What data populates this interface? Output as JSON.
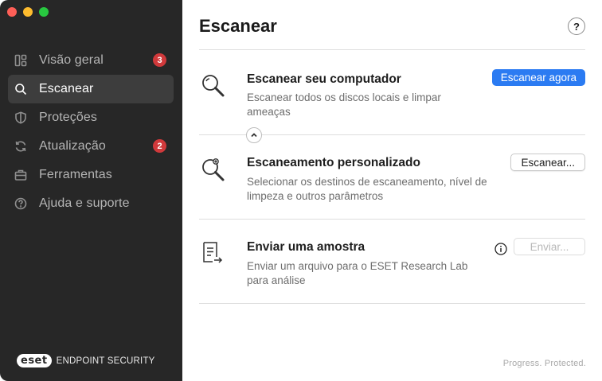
{
  "window": {
    "traffic_lights": [
      "close",
      "minimize",
      "zoom"
    ]
  },
  "sidebar": {
    "items": [
      {
        "label": "Visão geral",
        "icon": "dashboard-icon",
        "badge": "3",
        "active": false
      },
      {
        "label": "Escanear",
        "icon": "search-icon",
        "badge": null,
        "active": true
      },
      {
        "label": "Proteções",
        "icon": "shield-icon",
        "badge": null,
        "active": false
      },
      {
        "label": "Atualização",
        "icon": "refresh-icon",
        "badge": "2",
        "active": false
      },
      {
        "label": "Ferramentas",
        "icon": "briefcase-icon",
        "badge": null,
        "active": false
      },
      {
        "label": "Ajuda e suporte",
        "icon": "help-circle-icon",
        "badge": null,
        "active": false
      }
    ],
    "brand": {
      "logo": "eset",
      "name": "ENDPOINT SECURITY"
    }
  },
  "main": {
    "title": "Escanear",
    "help_label": "?",
    "cards": [
      {
        "title": "Escanear seu computador",
        "description": "Escanear todos os discos locais e limpar ameaças",
        "button": "Escanear agora",
        "icon": "magnifier-icon"
      },
      {
        "title": "Escaneamento personalizado",
        "description": "Selecionar os destinos de escaneamento, nível de limpeza e outros parâmetros",
        "button": "Escanear...",
        "icon": "magnifier-gear-icon"
      },
      {
        "title": "Enviar uma amostra",
        "description": "Enviar um arquivo para o ESET Research Lab para análise",
        "button": "Enviar...",
        "icon": "document-send-icon"
      }
    ],
    "footer": "Progress. Protected."
  },
  "colors": {
    "sidebar_bg": "#272727",
    "sidebar_active": "#3d3d3d",
    "accent": "#2b7bf2",
    "badge": "#d0393b"
  }
}
